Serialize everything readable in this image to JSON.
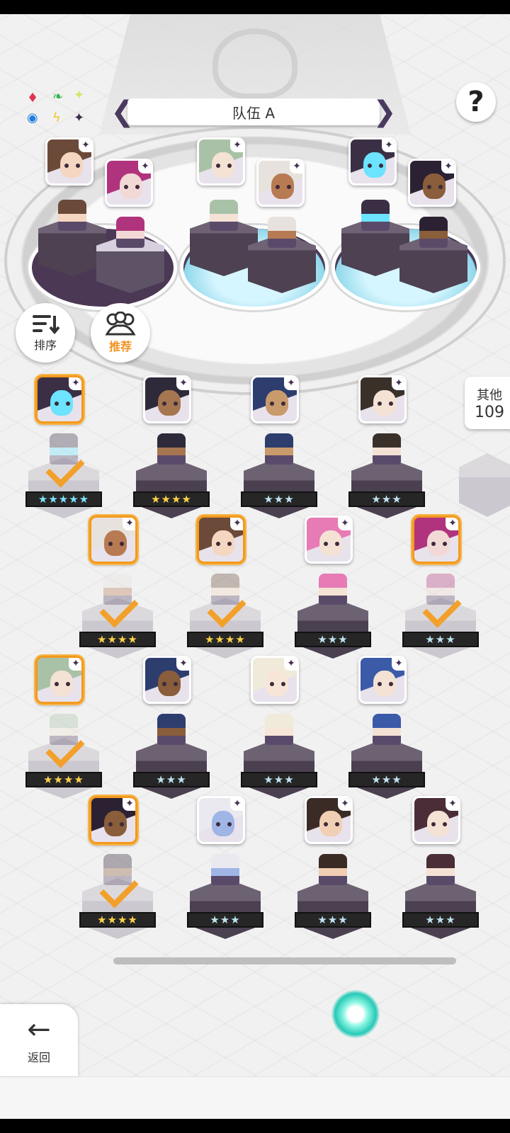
{
  "header": {
    "team_title": "队伍 A",
    "help_label": "?"
  },
  "legend": {
    "icons": [
      "red-diamond-icon",
      "green-leaf-icon",
      "sparkle-icon",
      "blue-circle-icon",
      "yellow-lightning-icon",
      "purple-star-icon"
    ]
  },
  "buttons": {
    "sort_label": "排序",
    "recommend_label": "推荐",
    "back_label": "返回"
  },
  "other_panel": {
    "label": "其他",
    "count": "109"
  },
  "team_slots": [
    {
      "portraits": [
        {
          "hair": "#6b4a3a",
          "skin": "#f5d6c0"
        },
        {
          "hair": "#b0347d",
          "skin": "#f3d9d5"
        }
      ]
    },
    {
      "portraits": [
        {
          "hair": "#a9c2a7",
          "skin": "#f4e2d4"
        },
        {
          "hair": "#e7e2dd",
          "skin": "#b87a53"
        }
      ]
    },
    {
      "portraits": [
        {
          "hair": "#3b2f45",
          "skin": "#6ce3ff"
        },
        {
          "hair": "#2c2133",
          "skin": "#8a5d3b"
        }
      ]
    }
  ],
  "roster": [
    {
      "stars": "★★★★★",
      "tier": 5,
      "selected": true,
      "hair": "#3b2f45",
      "skin": "#6ce3ff"
    },
    {
      "stars": "★★★★",
      "tier": 4,
      "selected": false,
      "hair": "#2e2a3a",
      "skin": "#a67650"
    },
    {
      "stars": "★★★",
      "tier": 3,
      "selected": false,
      "hair": "#2d3d6e",
      "skin": "#c99a6c"
    },
    {
      "stars": "★★★",
      "tier": 3,
      "selected": false,
      "hair": "#3a302a",
      "skin": "#f4e2d4"
    },
    {
      "stars": "★★★★",
      "tier": 4,
      "selected": true,
      "hair": "#e7e2dd",
      "skin": "#b87a53"
    },
    {
      "stars": "★★★★",
      "tier": 4,
      "selected": true,
      "hair": "#6b4a3a",
      "skin": "#f5d6c0"
    },
    {
      "stars": "★★★",
      "tier": 3,
      "selected": false,
      "hair": "#e67bb5",
      "skin": "#f4e2d4"
    },
    {
      "stars": "★★★",
      "tier": 3,
      "selected": true,
      "hair": "#b0347d",
      "skin": "#f3d9d5"
    },
    {
      "stars": "★★★★",
      "tier": 4,
      "selected": true,
      "hair": "#a9c2a7",
      "skin": "#f4e2d4"
    },
    {
      "stars": "★★★",
      "tier": 3,
      "selected": false,
      "hair": "#2d3d6e",
      "skin": "#8a5d3b"
    },
    {
      "stars": "★★★",
      "tier": 3,
      "selected": false,
      "hair": "#f0eadb",
      "skin": "#f7e6d8"
    },
    {
      "stars": "★★★",
      "tier": 3,
      "selected": false,
      "hair": "#3b5aa8",
      "skin": "#f4e2d4"
    },
    {
      "stars": "★★★★",
      "tier": 4,
      "selected": true,
      "hair": "#2c2133",
      "skin": "#8a5d3b"
    },
    {
      "stars": "★★★",
      "tier": 3,
      "selected": false,
      "hair": "#e9e9ef",
      "skin": "#9fb5e6"
    },
    {
      "stars": "★★★",
      "tier": 3,
      "selected": false,
      "hair": "#3a2b25",
      "skin": "#f1cfb4"
    },
    {
      "stars": "★★★",
      "tier": 3,
      "selected": false,
      "hair": "#4a2d36",
      "skin": "#f4e2d4"
    }
  ],
  "colors": {
    "accent_orange": "#f29a1e",
    "five_star": "#7fe3ff",
    "four_star": "#ffd24a",
    "three_star": "#bfe3f0",
    "pedestal": "#4b3855"
  }
}
